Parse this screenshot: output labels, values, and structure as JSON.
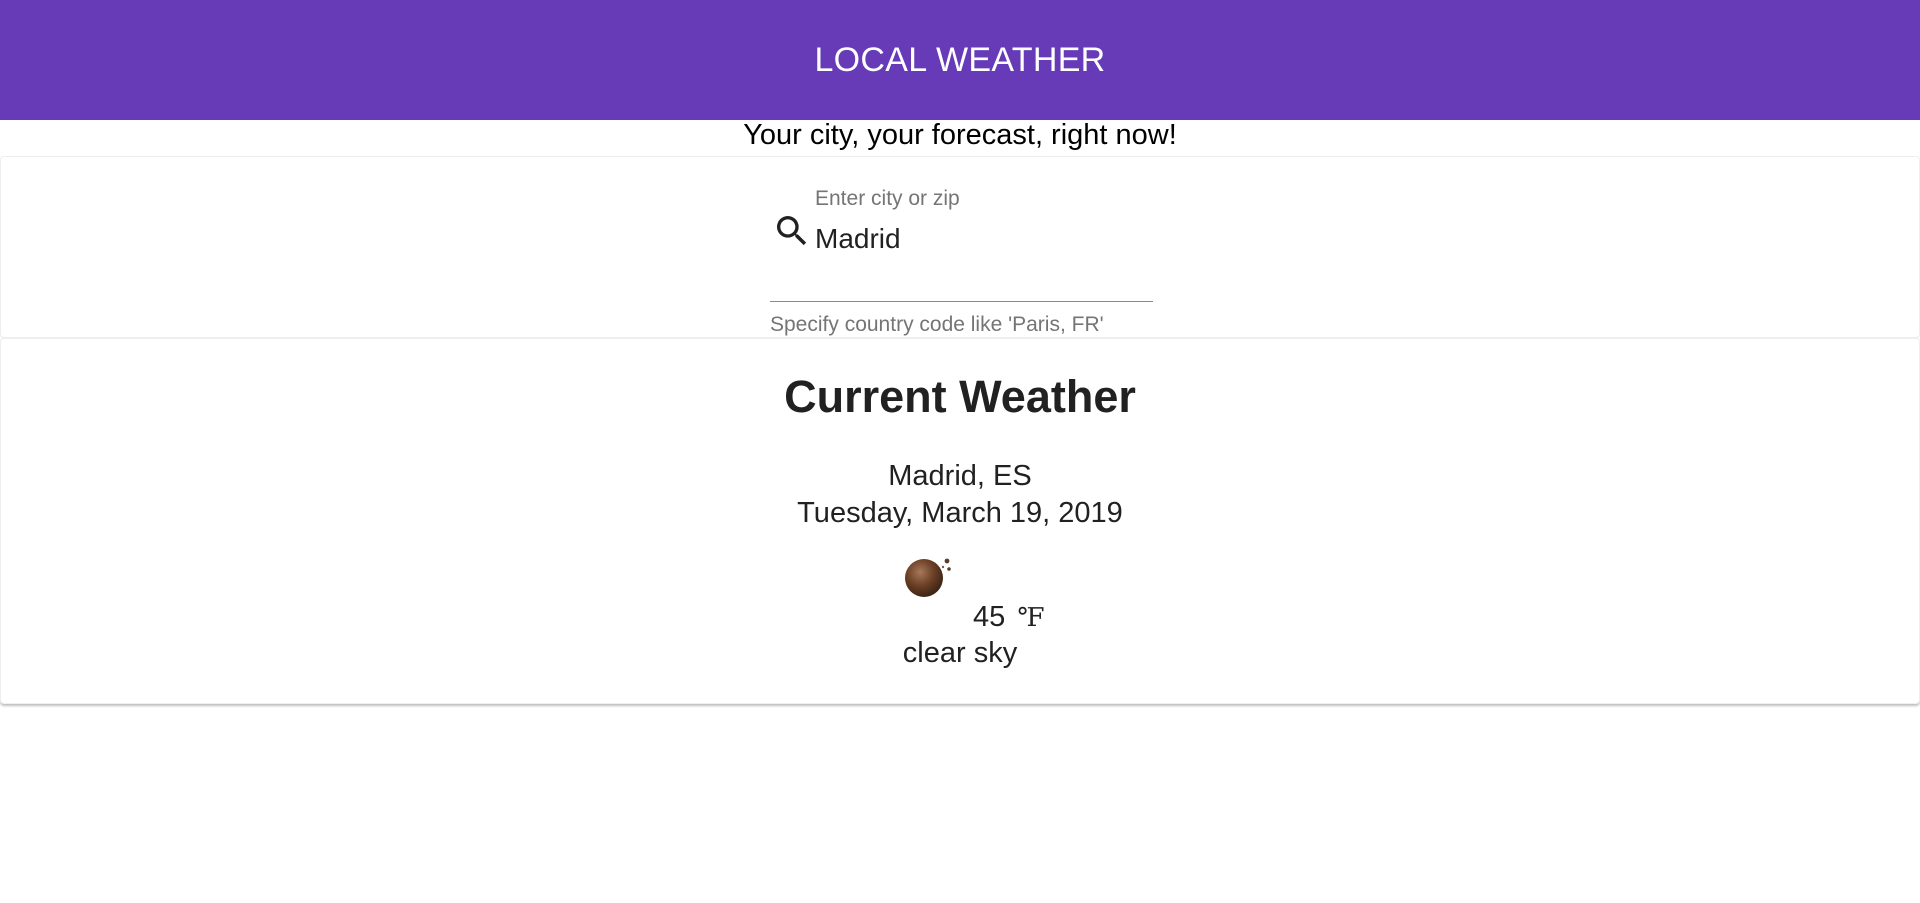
{
  "header": {
    "title": "LOCAL WEATHER",
    "color": "#673ab7"
  },
  "tagline": "Your city, your forecast, right now!",
  "search": {
    "label": "Enter city or zip",
    "value": "Madrid",
    "hint": "Specify country code like 'Paris, FR'",
    "icon": "search-icon"
  },
  "weather": {
    "title": "Current Weather",
    "location": "Madrid, ES",
    "date": "Tuesday, March 19, 2019",
    "icon": "clear-sky-night-icon",
    "temperature": "45",
    "unit": "℉",
    "description": "clear sky"
  }
}
